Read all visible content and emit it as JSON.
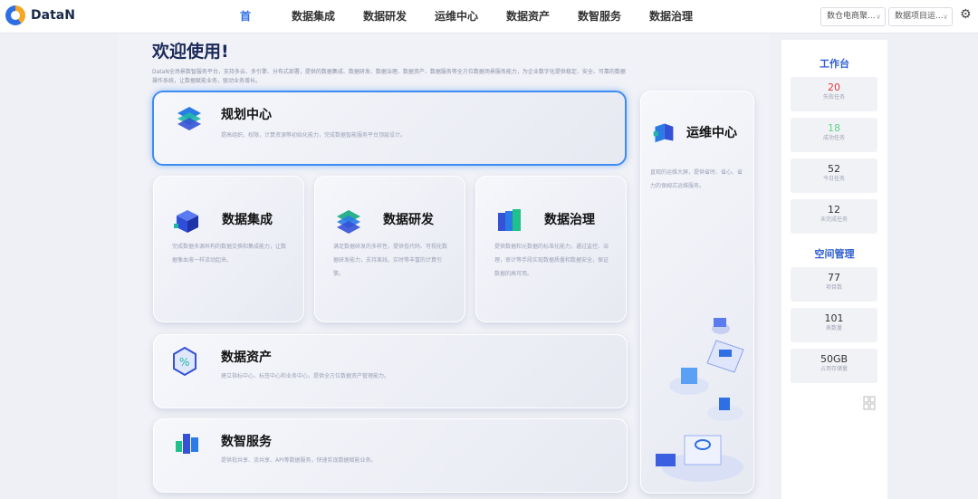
{
  "app": {
    "logo_text": "DataN"
  },
  "nav": {
    "items": [
      "首页",
      "数据集成",
      "数据研发",
      "运维中心",
      "数据资产",
      "数智服务",
      "数据治理"
    ],
    "active_index": 0
  },
  "header": {
    "select_1": "数仓电商聚...",
    "select_2": "数据项目运...",
    "chevron": "∨"
  },
  "main": {
    "welcome": "欢迎使用!",
    "description": "DataN全场景数智服务平台，支持多云、多引擎、分布式部署，提供的数据集成、数据研发、数据治理、数据资产、数据服务等全方位数据场景服务能力，为企业数字化提供稳定、安全、可靠的数据操作系统，让数据赋能业务，驱动业务增长。",
    "cards": {
      "plan": {
        "title": "规划中心",
        "desc": "提高组织，权限，计算资源等初始化能力，完成数据智能服务平台顶层设计。"
      },
      "integration": {
        "title": "数据集成",
        "desc": "完成数据多源异构的数据交换和集成能力，让数据像血液一样流动起来。"
      },
      "develop": {
        "title": "数据研发",
        "desc": "满足数据研发的多样性，提供低代码、可视化数据研发能力，支持离线，实时等丰富的计算引擎。"
      },
      "governance": {
        "title": "数据治理",
        "desc": "提供数据和元数据的标准化能力，通过监控、治理，审计等手段实现数据质量和数据安全，保证数据的高可用。"
      },
      "ops": {
        "title": "运维中心",
        "desc": "直观的运维大屏，提供省时、省心、省力的保姆式运维服务。"
      },
      "assets": {
        "title": "数据资产",
        "desc": "建立指标中心、标签中心和业务中心，提供全方位数据资产管理能力。"
      },
      "service": {
        "title": "数智服务",
        "desc": "提供批共享、流共享、API等数据服务，快速实现数据赋能业务。"
      }
    }
  },
  "panel": {
    "workbench_title": "工作台",
    "stats": [
      {
        "value": "20",
        "label": "失败任务",
        "color": "#e0393e"
      },
      {
        "value": "18",
        "label": "成功任务",
        "color": "#5fd38d"
      },
      {
        "value": "52",
        "label": "今日任务",
        "color": "#333333"
      },
      {
        "value": "12",
        "label": "未完成任务",
        "color": "#333333"
      }
    ],
    "space_title": "空间管理",
    "space": [
      {
        "value": "77",
        "label": "项目数"
      },
      {
        "value": "101",
        "label": "表数量"
      },
      {
        "value": "50GB",
        "label": "占用存储量"
      }
    ]
  },
  "colors": {
    "accent": "#2f6fe4",
    "highlight_border": "#3f8df2",
    "title_blue": "#2f5fd0"
  }
}
